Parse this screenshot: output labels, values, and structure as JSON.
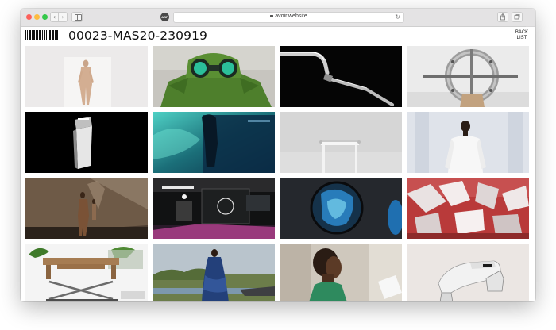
{
  "browser": {
    "url": "avoir.website",
    "extension_label": "ABP",
    "nav_back": "‹",
    "nav_forward": "›",
    "reload_icon": "↻",
    "new_tab": "+"
  },
  "page": {
    "title": "00023-MAS20-230919",
    "back_list": "BACK LIST"
  },
  "thumbnails": [
    {
      "subject": "model-nude-bodysuit"
    },
    {
      "subject": "person-with-binoculars"
    },
    {
      "subject": "chrome-faucet-black"
    },
    {
      "subject": "circular-sculpture"
    },
    {
      "subject": "floating-panel-dark"
    },
    {
      "subject": "underwater-scene"
    },
    {
      "subject": "white-stand-object"
    },
    {
      "subject": "model-white-sweater"
    },
    {
      "subject": "runway-stairs"
    },
    {
      "subject": "dark-control-room"
    },
    {
      "subject": "reflective-sphere"
    },
    {
      "subject": "red-shards-installation"
    },
    {
      "subject": "table-on-scissor-lift"
    },
    {
      "subject": "model-in-field"
    },
    {
      "subject": "person-side-profile"
    },
    {
      "subject": "platform-shoe"
    }
  ]
}
